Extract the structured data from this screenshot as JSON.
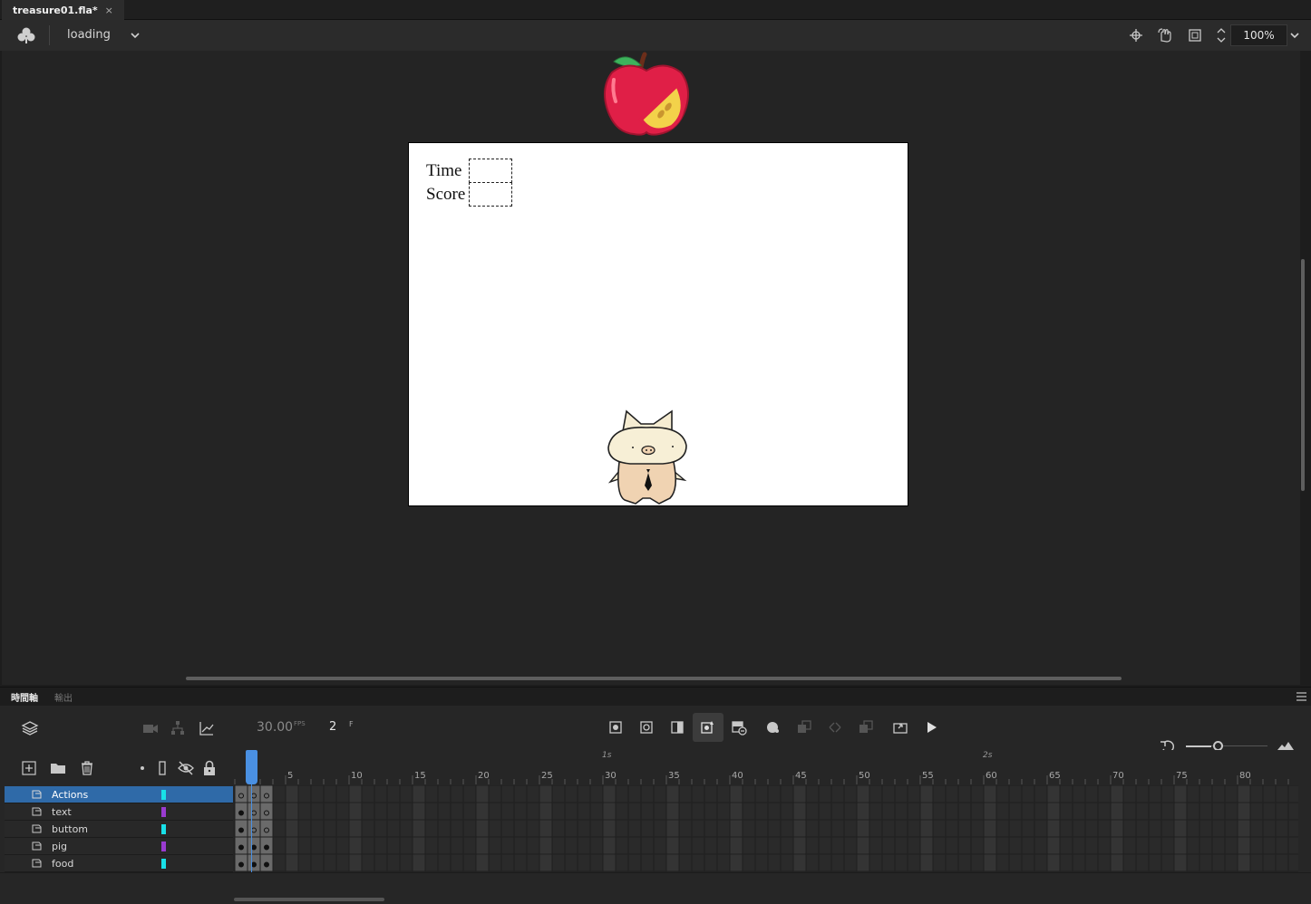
{
  "document": {
    "tab_title": "treasure01.fla*",
    "close_glyph": "×"
  },
  "editbar": {
    "scene_name": "loading",
    "zoom": "100%"
  },
  "stage": {
    "time_label": "Time",
    "score_label": "Score"
  },
  "panel": {
    "tabs": [
      "時間軸",
      "輸出"
    ]
  },
  "timeline": {
    "fps": "30.00",
    "fps_unit": "FPS",
    "current_frame": "2",
    "frame_unit": "F",
    "ruler": {
      "numbers": [
        "5",
        "10",
        "15",
        "20",
        "25",
        "30",
        "35",
        "40",
        "45",
        "50",
        "55",
        "60",
        "65",
        "70",
        "75",
        "80"
      ],
      "seconds": [
        "1s",
        "2s"
      ]
    },
    "layers": [
      {
        "name": "Actions",
        "color": "#18e0e8",
        "selected": true
      },
      {
        "name": "text",
        "color": "#9a3bd0",
        "selected": false
      },
      {
        "name": "buttom",
        "color": "#18e0e8",
        "selected": false
      },
      {
        "name": "pig",
        "color": "#9a3bd0",
        "selected": false
      },
      {
        "name": "food",
        "color": "#18e0e8",
        "selected": false
      }
    ]
  }
}
